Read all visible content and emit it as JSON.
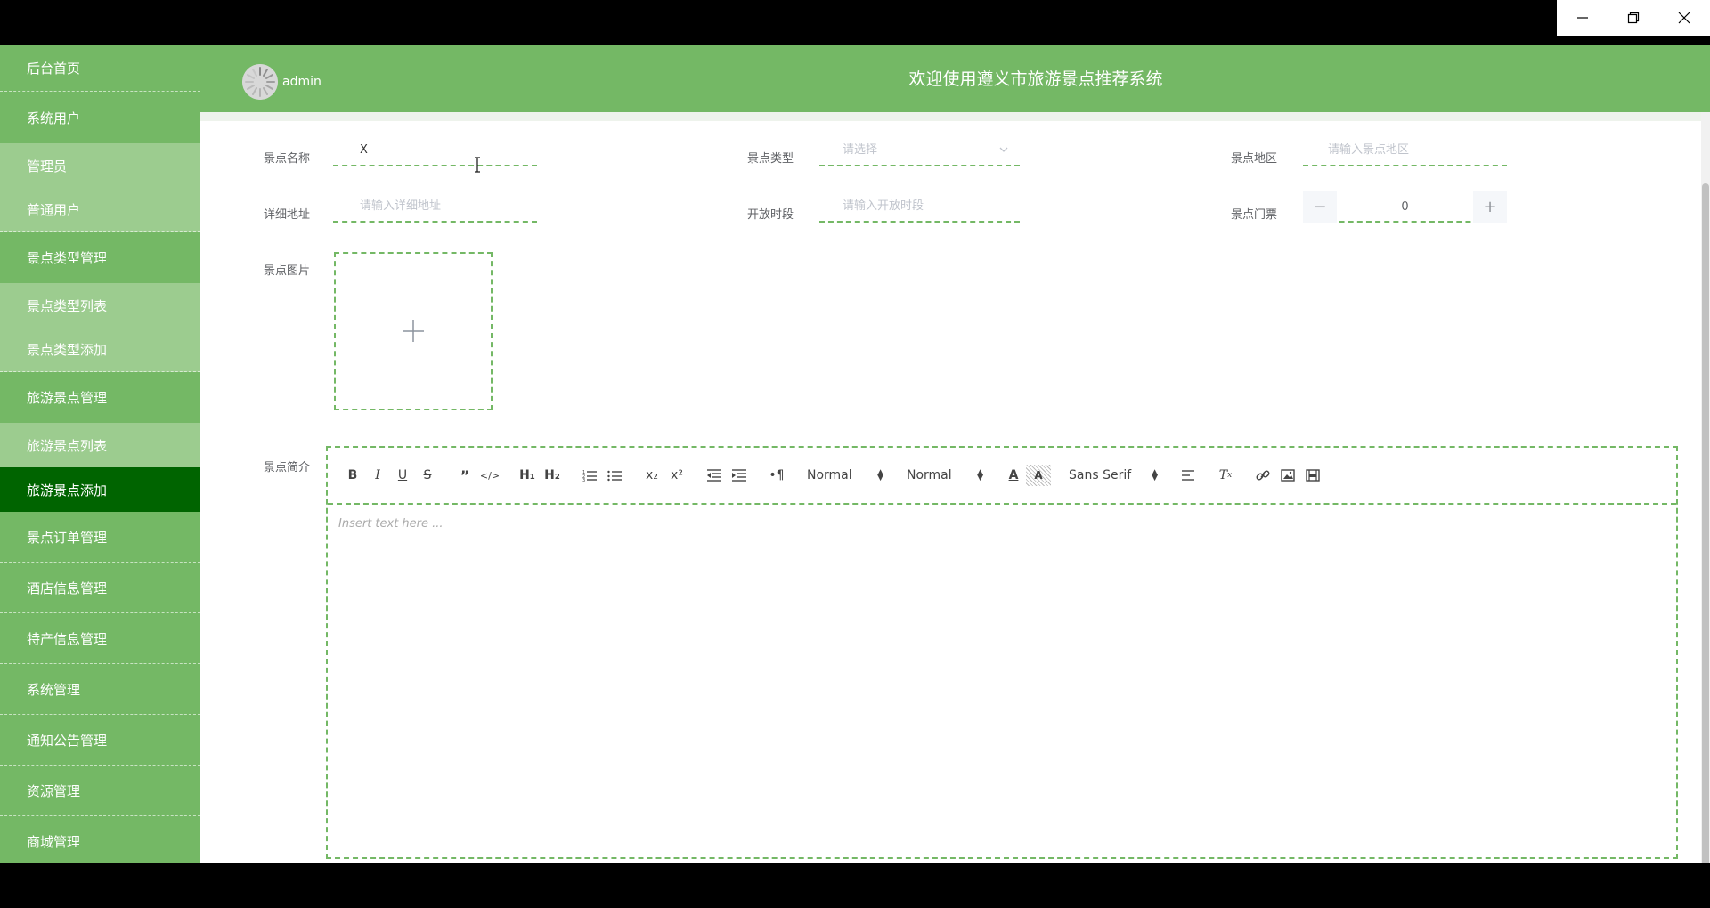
{
  "window": {
    "controls": [
      "minimize",
      "restore",
      "close"
    ]
  },
  "sidebar": {
    "items": [
      {
        "label": "后台首页",
        "type": "top"
      },
      {
        "label": "系统用户",
        "type": "top"
      },
      {
        "label": "管理员",
        "type": "sub"
      },
      {
        "label": "普通用户",
        "type": "sub"
      },
      {
        "label": "景点类型管理",
        "type": "top"
      },
      {
        "label": "景点类型列表",
        "type": "sub"
      },
      {
        "label": "景点类型添加",
        "type": "sub"
      },
      {
        "label": "旅游景点管理",
        "type": "top"
      },
      {
        "label": "旅游景点列表",
        "type": "sub"
      },
      {
        "label": "旅游景点添加",
        "type": "active"
      },
      {
        "label": "景点订单管理",
        "type": "top"
      },
      {
        "label": "酒店信息管理",
        "type": "top"
      },
      {
        "label": "特产信息管理",
        "type": "top"
      },
      {
        "label": "系统管理",
        "type": "top"
      },
      {
        "label": "通知公告管理",
        "type": "top"
      },
      {
        "label": "资源管理",
        "type": "top"
      },
      {
        "label": "商城管理",
        "type": "top"
      }
    ]
  },
  "header": {
    "username": "admin",
    "title": "欢迎使用遵义市旅游景点推荐系统"
  },
  "form": {
    "name_label": "景点名称",
    "name_value": "X",
    "type_label": "景点类型",
    "type_placeholder": "请选择",
    "region_label": "景点地区",
    "region_placeholder": "请输入景点地区",
    "address_label": "详细地址",
    "address_placeholder": "请输入详细地址",
    "hours_label": "开放时段",
    "hours_placeholder": "请输入开放时段",
    "ticket_label": "景点门票",
    "ticket_value": "0",
    "ticket_minus": "−",
    "ticket_plus": "+",
    "image_label": "景点图片",
    "intro_label": "景点简介"
  },
  "editor": {
    "header_select": "Normal",
    "size_select": "Normal",
    "font_select": "Sans Serif",
    "placeholder": "Insert text here ..."
  },
  "colors": {
    "primary": "#74b865",
    "sub_bg": "#9ccc8f",
    "active_bg": "#006400"
  }
}
